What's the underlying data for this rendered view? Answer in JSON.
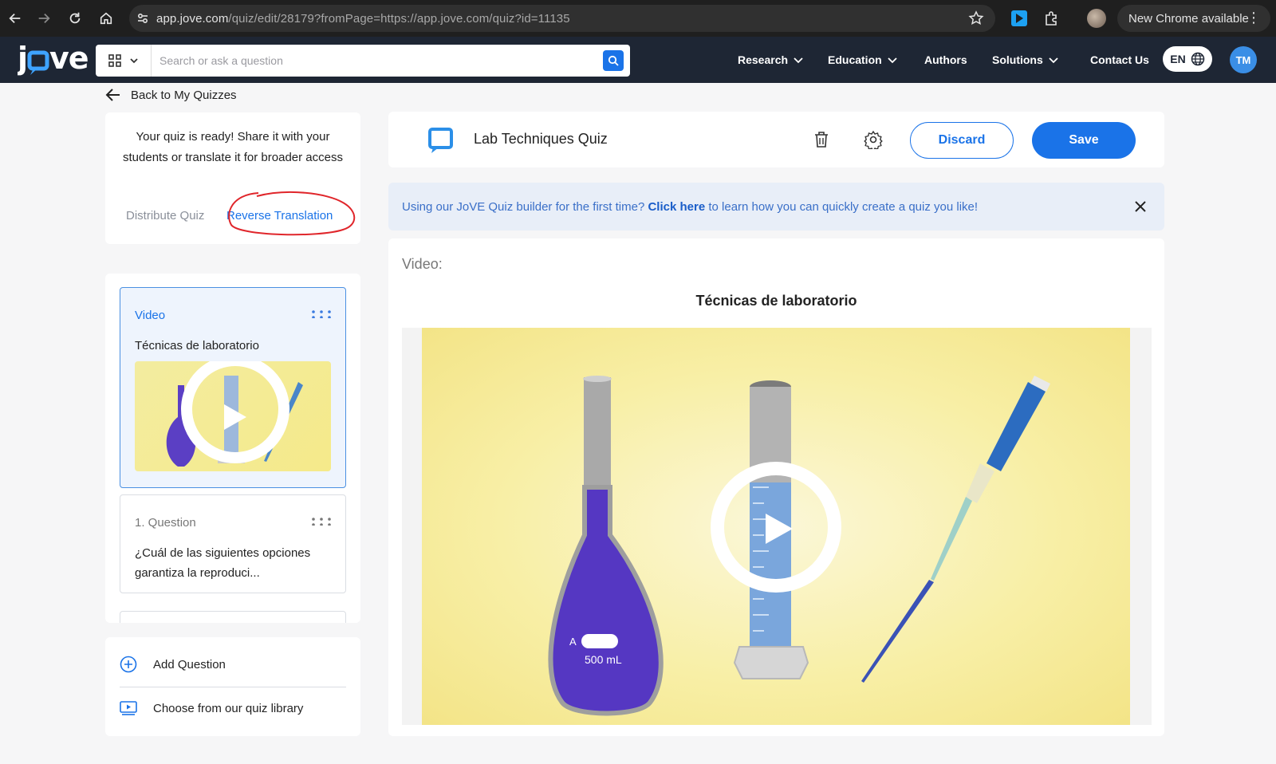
{
  "browser": {
    "url_host": "app.jove.com",
    "url_path": "/quiz/edit/28179?fromPage=https://app.jove.com/quiz?id=11135",
    "update_label": "New Chrome available"
  },
  "header": {
    "search_placeholder": "Search or ask a question",
    "nav": {
      "research": "Research",
      "education": "Education",
      "authors": "Authors",
      "solutions": "Solutions",
      "contact": "Contact Us"
    },
    "language": "EN",
    "avatar_initials": "TM"
  },
  "back_link": "Back to My Quizzes",
  "share_panel": {
    "message": "Your quiz is ready! Share it with your students or translate it for broader access",
    "tab_distribute": "Distribute Quiz",
    "tab_reverse": "Reverse Translation"
  },
  "items": [
    {
      "type": "Video",
      "text": "Técnicas de laboratorio"
    },
    {
      "type": "1. Question",
      "text": "¿Cuál de las siguientes opciones garantiza la reproduci..."
    }
  ],
  "actions": {
    "add_question": "Add Question",
    "choose_library": "Choose from our quiz library"
  },
  "editor": {
    "quiz_title": "Lab Techniques Quiz",
    "discard_label": "Discard",
    "save_label": "Save",
    "banner_pre": "Using our JoVE Quiz builder for the first time?",
    "banner_link": "Click here",
    "banner_post": "to learn how you can quickly create a quiz you like!",
    "video_label": "Video:",
    "video_title": "Técnicas de laboratorio",
    "flask_label": "500 mL",
    "flask_mark": "A"
  },
  "colors": {
    "accent": "#1a73e8",
    "header_bg": "#1e2634",
    "annotation": "#e0262b"
  }
}
